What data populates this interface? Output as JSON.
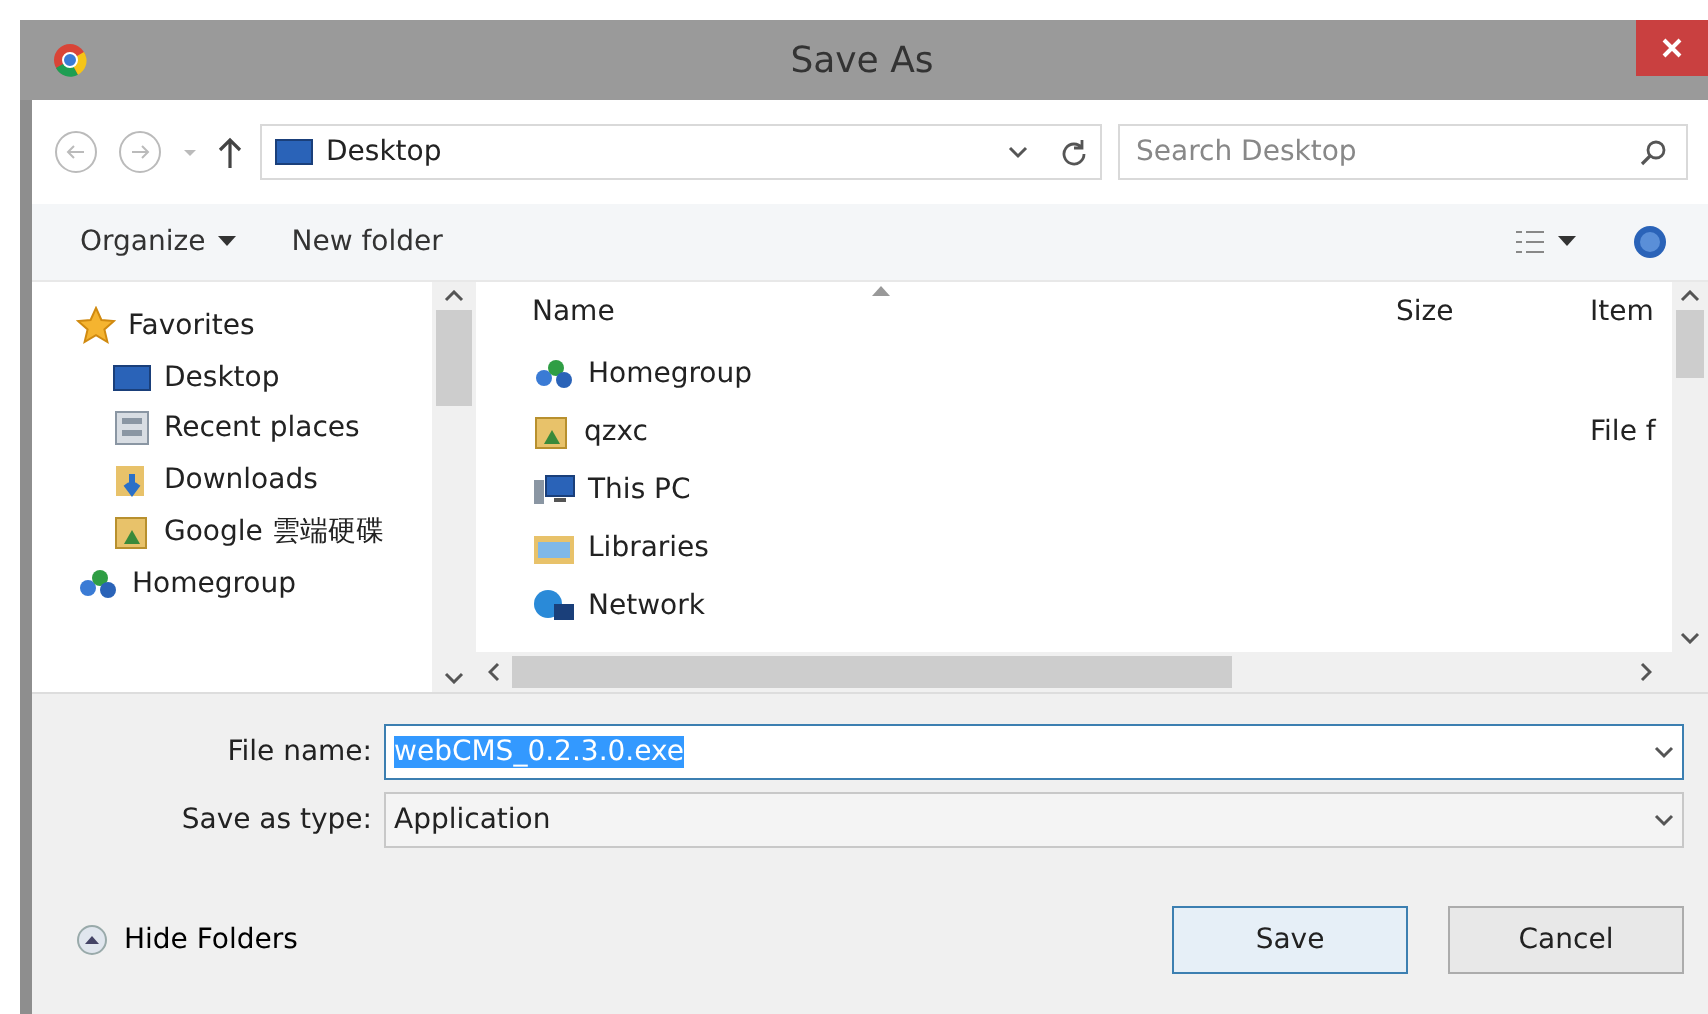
{
  "window": {
    "title": "Save As"
  },
  "nav": {
    "location": "Desktop",
    "search": {
      "placeholder": "Search Desktop"
    }
  },
  "toolbar": {
    "organize": "Organize",
    "new_folder": "New folder"
  },
  "sidebar": {
    "items": [
      {
        "label": "Favorites",
        "kind": "header"
      },
      {
        "label": "Desktop",
        "kind": "item"
      },
      {
        "label": "Recent places",
        "kind": "item"
      },
      {
        "label": "Downloads",
        "kind": "item"
      },
      {
        "label": "Google 雲端硬碟",
        "kind": "item"
      },
      {
        "label": "Homegroup",
        "kind": "header"
      }
    ]
  },
  "table": {
    "columns": [
      "Name",
      "Size",
      "Item"
    ],
    "rows": [
      {
        "name": "Homegroup"
      },
      {
        "name": "qzxc",
        "column_3": "File f"
      },
      {
        "name": "This PC"
      },
      {
        "name": "Libraries"
      },
      {
        "name": "Network"
      }
    ]
  },
  "file_name": {
    "label": "File name:",
    "value": "webCMS_0.2.3.0.exe",
    "selected": true
  },
  "save_type": {
    "label": "Save as type:",
    "value": "Application"
  },
  "hide_folders": "Hide Folders",
  "buttons": [
    {
      "label": "Save",
      "default": true
    },
    {
      "label": "Cancel",
      "default": false
    }
  ]
}
